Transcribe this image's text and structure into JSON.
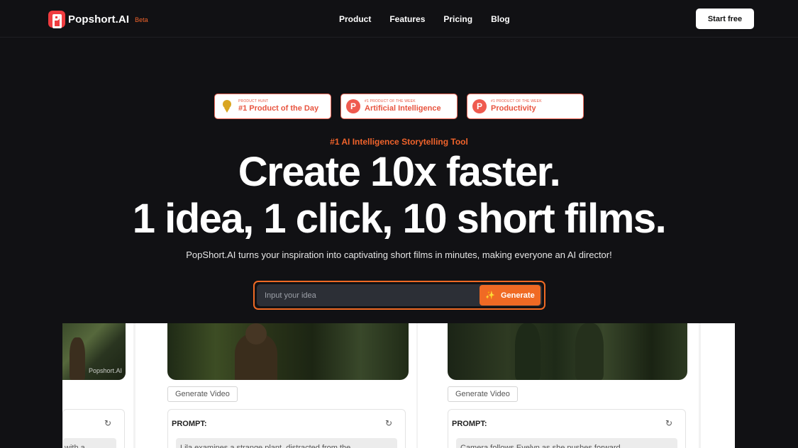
{
  "nav": {
    "brand": "Popshort.AI",
    "beta": "Beta",
    "links": [
      "Product",
      "Features",
      "Pricing",
      "Blog"
    ],
    "cta": "Start free"
  },
  "badges": [
    {
      "icon": "medal-icon",
      "small": "PRODUCT HUNT",
      "big": "#1 Product of the Day"
    },
    {
      "icon": "producthunt-icon",
      "small": "#1 PRODUCT OF THE WEEK",
      "big": "Artificial Intelligence"
    },
    {
      "icon": "producthunt-icon",
      "small": "#1 PRODUCT OF THE WEEK",
      "big": "Productivity"
    }
  ],
  "hero": {
    "tag": "#1 AI Intelligence Storytelling Tool",
    "line1": "Create 10x faster.",
    "line2": "1 idea, 1 click, 10 short films.",
    "sub": "PopShort.AI turns your inspiration into captivating short films in minutes, making everyone an AI director!"
  },
  "search": {
    "placeholder": "Input your idea",
    "button": "Generate"
  },
  "cards": [
    {
      "watermark": "Popshort.AI",
      "prompt_text": "with a"
    },
    {
      "button": "Generate Video",
      "prompt_label": "PROMPT:",
      "prompt_text": "Lila examines a strange plant, distracted from the"
    },
    {
      "button": "Generate Video",
      "prompt_label": "PROMPT:",
      "prompt_text": "Camera follows Evelyn as she pushes forward"
    }
  ],
  "colors": {
    "accent": "#f06a24",
    "badge": "#e8543f",
    "bg": "#111114"
  }
}
